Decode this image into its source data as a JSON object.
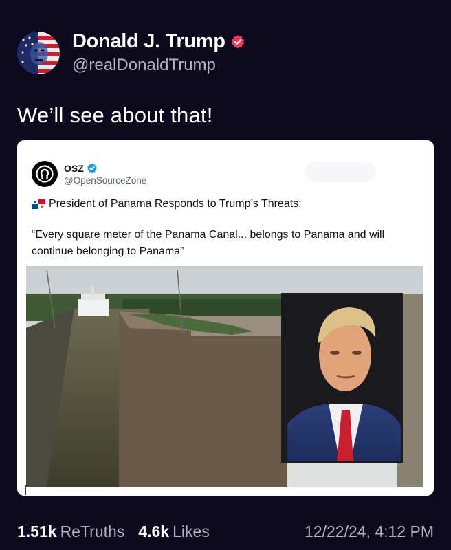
{
  "post": {
    "display_name": "Donald J. Trump",
    "handle": "@realDonaldTrump",
    "text": "We’ll see about that!",
    "avatar_icon": "flag-portrait-avatar",
    "verified_icon": "verified-badge-icon",
    "verified_color": "#e9385b"
  },
  "quoted": {
    "display_name": "OSZ",
    "handle": "@OpenSourceZone",
    "verified_color": "#1d9bf0",
    "headline": "President of Panama Responds to Trump’s Threats:",
    "flag_icon": "panama-flag-icon",
    "quote": "“Every square meter of the Panama Canal... belongs to Panama and will continue belonging to Panama”",
    "image_description_icon": "panama-canal-photo"
  },
  "stats": {
    "retruths_count": "1.51k",
    "retruths_label": "ReTruths",
    "likes_count": "4.6k",
    "likes_label": "Likes",
    "timestamp": "12/22/24, 4:12 PM"
  },
  "colors": {
    "background": "#0c0a1c",
    "muted_text": "#b3b2c3"
  }
}
